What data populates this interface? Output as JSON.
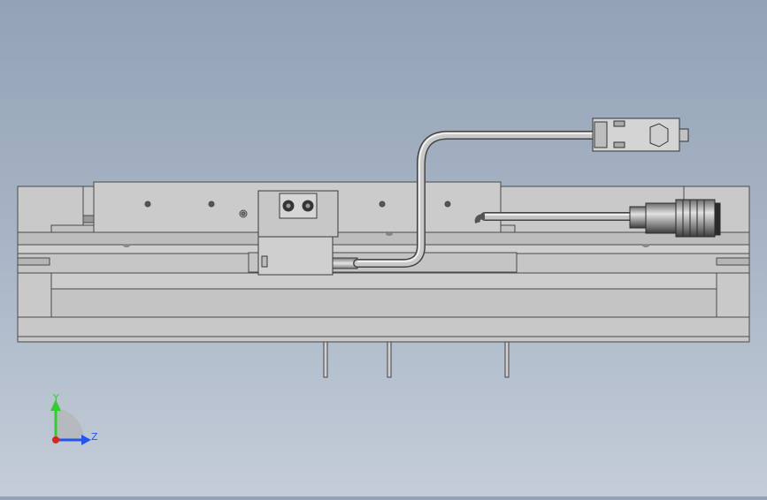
{
  "triad": {
    "y_label": "Y",
    "z_label": "Z",
    "y_color": "#33cc33",
    "z_color": "#2255ee",
    "x_color": "#dd2222"
  },
  "colors": {
    "body_fill": "#c9c9c9",
    "body_stroke": "#4a4a4a",
    "cable": "#b8b8b8",
    "connector_dark": "#3a3a3a"
  }
}
